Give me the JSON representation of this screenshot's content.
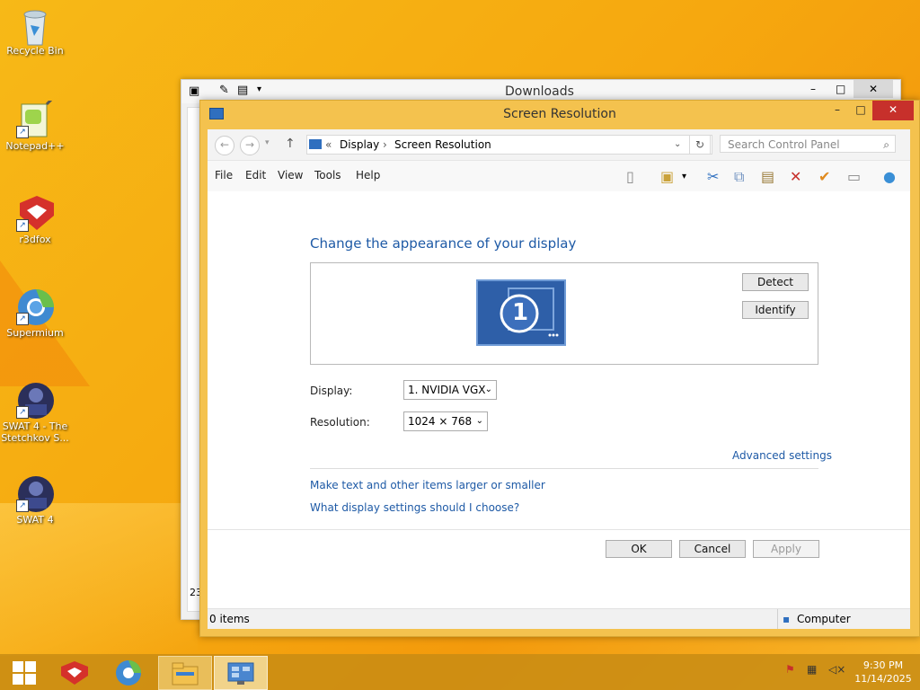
{
  "desktop": {
    "icons": [
      {
        "label": "Recycle Bin",
        "icon": "recycle-bin-icon"
      },
      {
        "label": "Notepad++",
        "icon": "notepad-plus-plus-icon"
      },
      {
        "label": "r3dfox",
        "icon": "r3dfox-icon"
      },
      {
        "label": "Supermium",
        "icon": "supermium-icon"
      },
      {
        "label": "SWAT 4 - The Stetchkov S...",
        "icon": "swat4-expansion-icon"
      },
      {
        "label": "SWAT 4",
        "icon": "swat4-icon"
      }
    ]
  },
  "downloads_window": {
    "title": "Downloads",
    "side_text": "23"
  },
  "window": {
    "title": "Screen Resolution",
    "minimize": "–",
    "maximize": "□",
    "close": "✕"
  },
  "address": {
    "prefix": "«",
    "crumb1": "Display",
    "separator": "›",
    "crumb2": "Screen Resolution",
    "search_placeholder": "Search Control Panel"
  },
  "menu": {
    "file": "File",
    "edit": "Edit",
    "view": "View",
    "tools": "Tools",
    "help": "Help"
  },
  "main": {
    "heading": "Change the appearance of your display",
    "monitor_number": "1",
    "detect": "Detect",
    "identify": "Identify",
    "display_label": "Display:",
    "display_value": "1. NVIDIA VGX",
    "resolution_label": "Resolution:",
    "resolution_value": "1024 × 768",
    "advanced": "Advanced settings",
    "link1": "Make text and other items larger or smaller",
    "link2": "What display settings should I choose?",
    "ok": "OK",
    "cancel": "Cancel",
    "apply": "Apply"
  },
  "status": {
    "items": "0 items",
    "computer": "Computer"
  },
  "taskbar": {
    "time": "9:30 PM",
    "date": "11/14/2025"
  }
}
